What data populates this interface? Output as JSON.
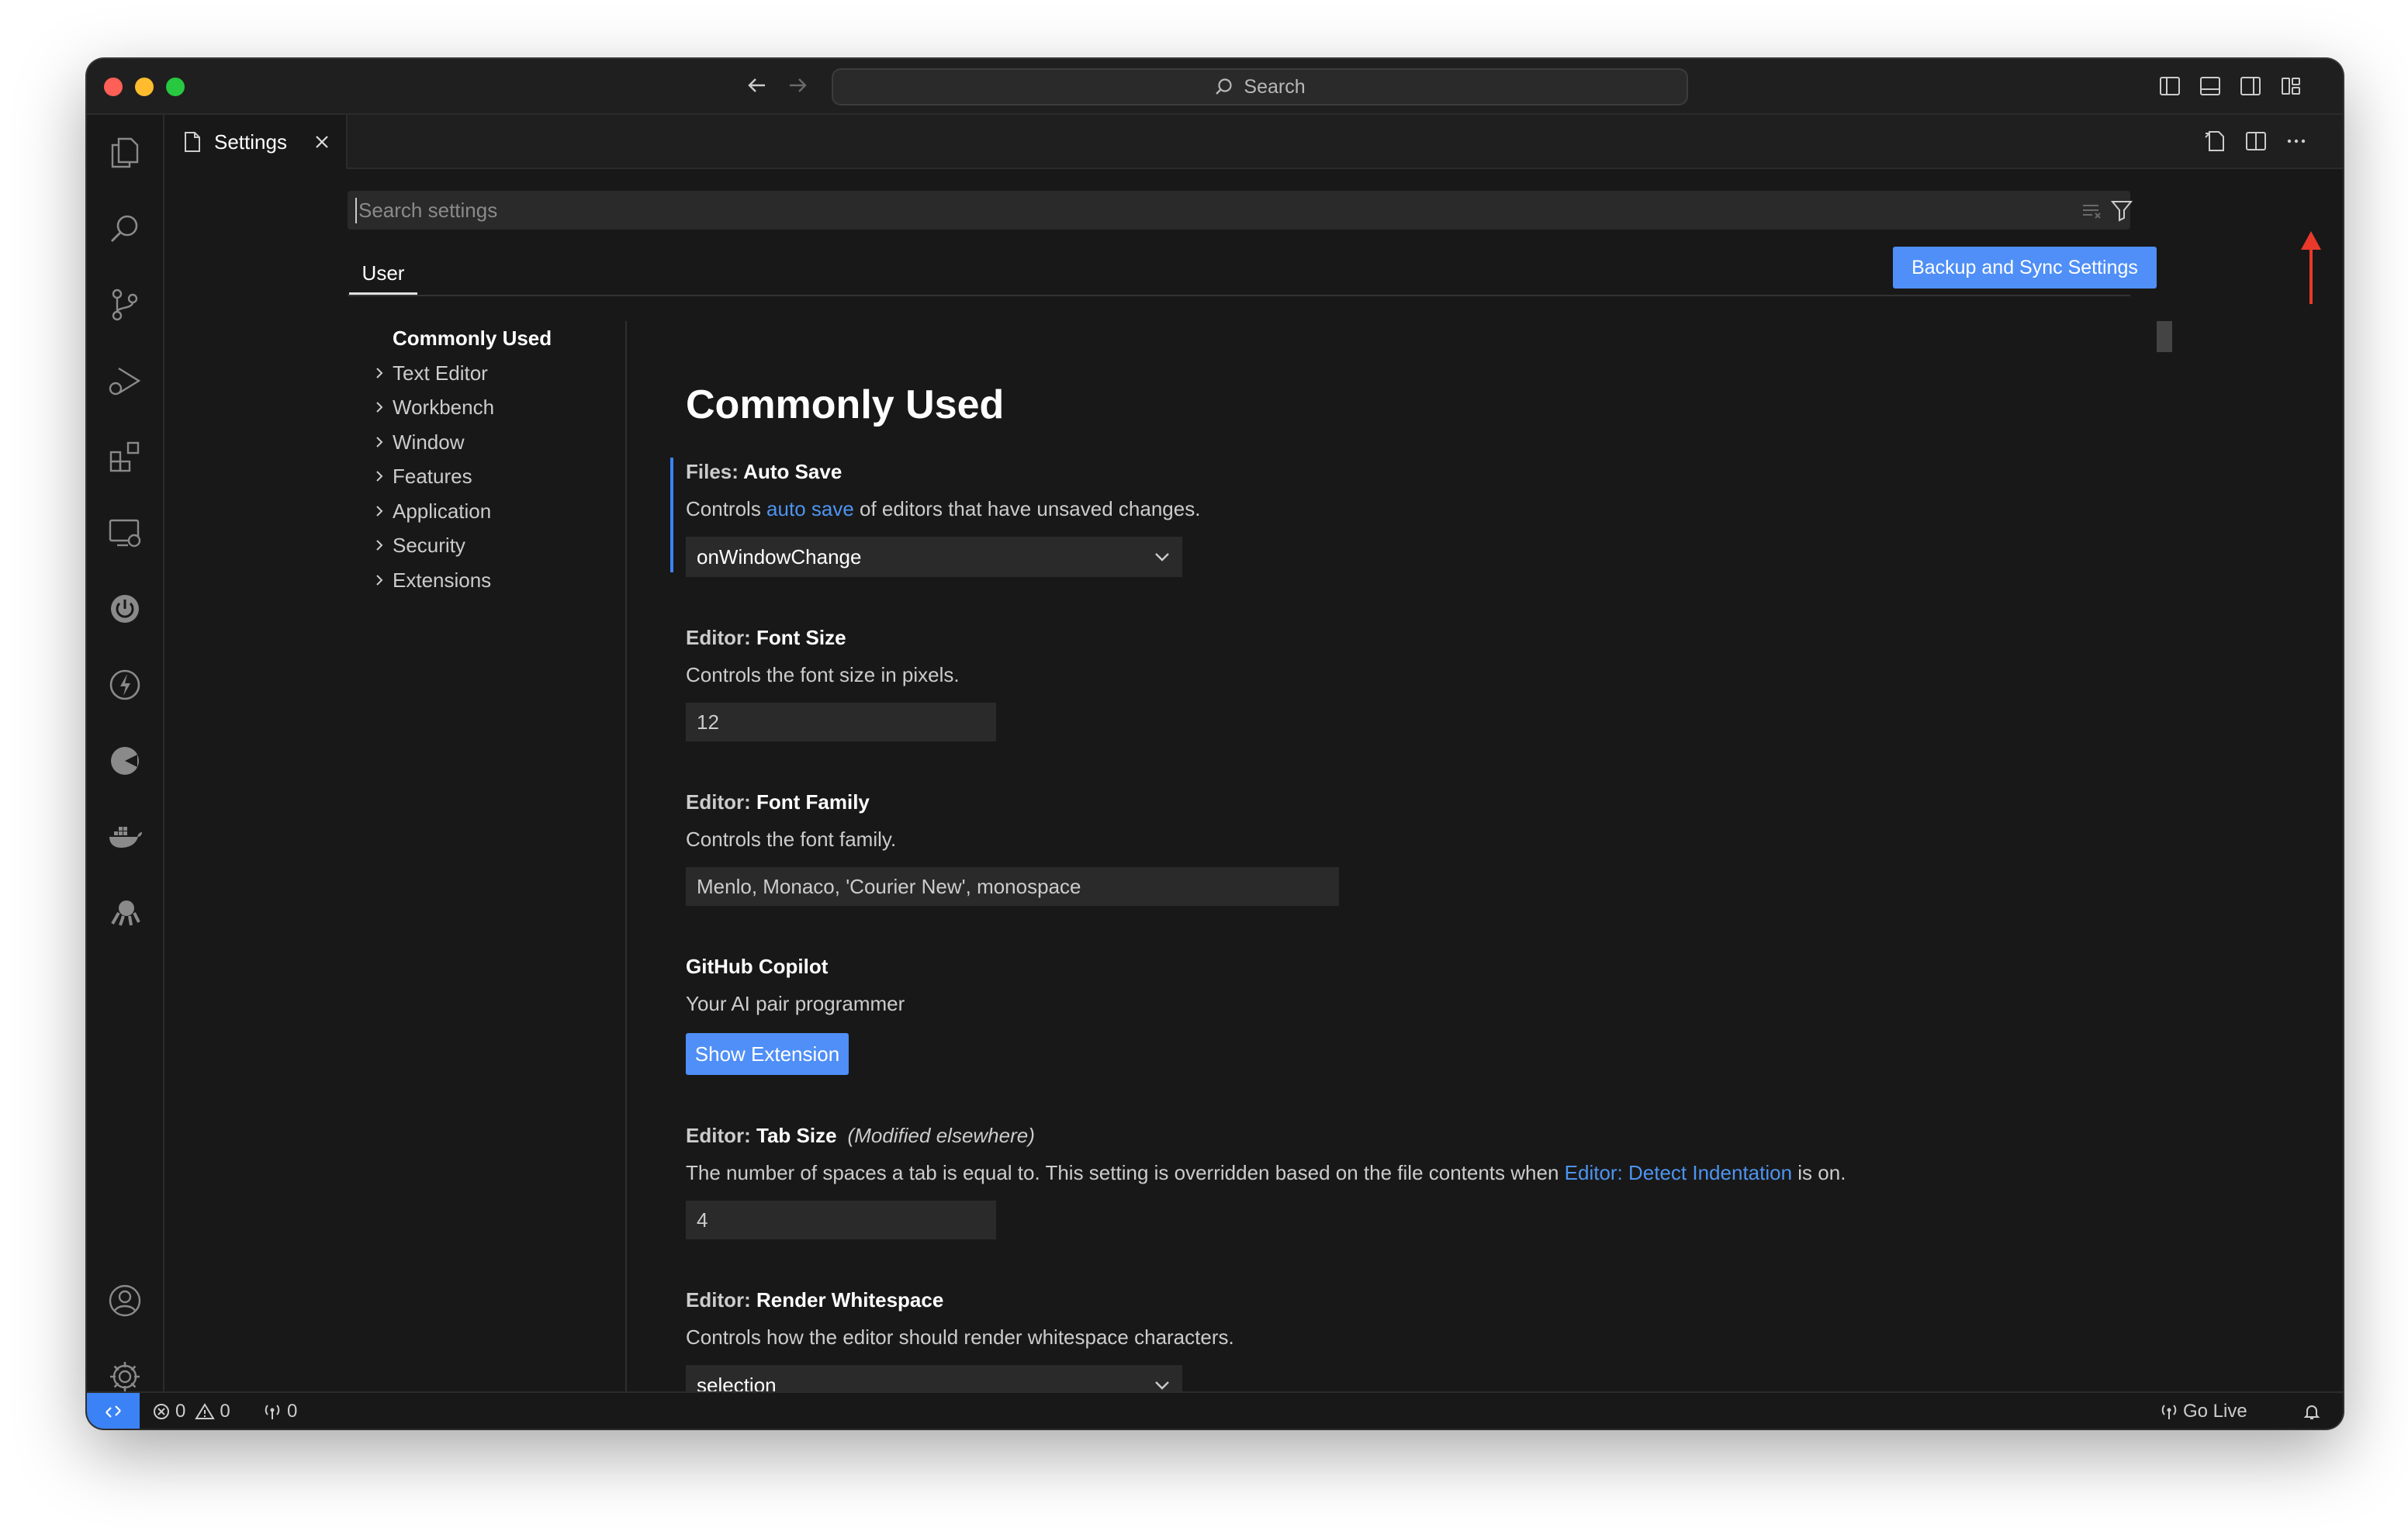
{
  "titlebar": {
    "search_label": "Search"
  },
  "tab": {
    "label": "Settings"
  },
  "settings_search": {
    "placeholder": "Search settings"
  },
  "scope": {
    "user_label": "User",
    "backup_button": "Backup and Sync Settings"
  },
  "toc": [
    {
      "label": "Commonly Used",
      "active": true
    },
    {
      "label": "Text Editor"
    },
    {
      "label": "Workbench"
    },
    {
      "label": "Window"
    },
    {
      "label": "Features"
    },
    {
      "label": "Application"
    },
    {
      "label": "Security"
    },
    {
      "label": "Extensions"
    }
  ],
  "section_title": "Commonly Used",
  "settings": {
    "auto_save": {
      "category": "Files: ",
      "name": "Auto Save",
      "desc_before": "Controls ",
      "desc_link": "auto save",
      "desc_after": " of editors that have unsaved changes.",
      "value": "onWindowChange"
    },
    "font_size": {
      "category": "Editor: ",
      "name": "Font Size",
      "desc": "Controls the font size in pixels.",
      "value": "12"
    },
    "font_family": {
      "category": "Editor: ",
      "name": "Font Family",
      "desc": "Controls the font family.",
      "value": "Menlo, Monaco, 'Courier New', monospace"
    },
    "copilot": {
      "name": "GitHub Copilot",
      "desc": "Your AI pair programmer",
      "button": "Show Extension"
    },
    "tab_size": {
      "category": "Editor: ",
      "name": "Tab Size",
      "modified": "(Modified elsewhere)",
      "desc_before": "The number of spaces a tab is equal to. This setting is overridden based on the file contents when ",
      "desc_link": "Editor: Detect Indentation",
      "desc_after": " is on.",
      "value": "4"
    },
    "render_whitespace": {
      "category": "Editor: ",
      "name": "Render Whitespace",
      "desc": "Controls how the editor should render whitespace characters.",
      "value": "selection"
    }
  },
  "statusbar": {
    "errors": "0",
    "warnings": "0",
    "ports": "0",
    "go_live": "Go Live"
  },
  "colors": {
    "accent": "#4f8ff7",
    "link": "#4e94f0",
    "annotation_arrow": "#e8392b"
  },
  "icons": [
    "files-icon",
    "search-icon",
    "source-control-icon",
    "run-debug-icon",
    "extensions-icon",
    "remote-explorer-icon",
    "power-icon",
    "lightning-icon",
    "pie-icon",
    "docker-icon",
    "octopus-icon",
    "account-icon",
    "gear-icon",
    "filter-icon",
    "clear-filter-icon",
    "open-json-icon",
    "split-editor-icon",
    "more-icon",
    "bell-icon",
    "broadcast-icon"
  ]
}
